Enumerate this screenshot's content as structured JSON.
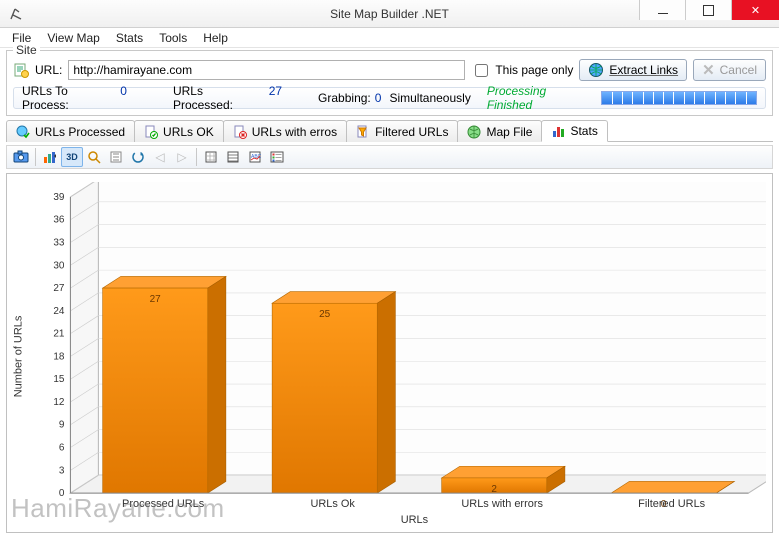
{
  "window": {
    "title": "Site Map Builder .NET",
    "minimize_label": "Minimize",
    "maximize_label": "Maximize",
    "close_label": "Close"
  },
  "menubar": [
    "File",
    "View Map",
    "Stats",
    "Tools",
    "Help"
  ],
  "site": {
    "group_label": "Site",
    "url_label": "URL:",
    "url_value": "http://hamirayane.com",
    "this_page_only_label": "This page only",
    "extract_links_label": "Extract Links",
    "cancel_label": "Cancel"
  },
  "status": {
    "urls_to_process_label": "URLs To Process:",
    "urls_to_process_value": "0",
    "urls_processed_label": "URLs Processed:",
    "urls_processed_value": "27",
    "grabbing_label": "Grabbing:",
    "grabbing_value": "0",
    "simultaneously_label": "Simultaneously",
    "processing_label": "Processing Finished"
  },
  "tabs": [
    {
      "label": "URLs Processed",
      "icon": "globe-check-icon"
    },
    {
      "label": "URLs OK",
      "icon": "page-ok-icon"
    },
    {
      "label": "URLs with erros",
      "icon": "page-error-icon"
    },
    {
      "label": "Filtered URLs",
      "icon": "filter-icon"
    },
    {
      "label": "Map File",
      "icon": "map-icon"
    },
    {
      "label": "Stats",
      "icon": "stats-icon"
    }
  ],
  "toolbar_icons": [
    "camera-icon",
    "chart-type-icon",
    "3d-toggle-icon",
    "zoom-icon",
    "scroll-icon",
    "rotate-icon",
    "left-icon",
    "right-icon",
    "grid-icon",
    "palette-icon",
    "axis-icon",
    "legend-icon"
  ],
  "chart_data": {
    "type": "bar",
    "xlabel": "URLs",
    "ylabel": "Number of URLs",
    "categories": [
      "Processed URLs",
      "URLs Ok",
      "URLs with errors",
      "Filtered URLs"
    ],
    "values": [
      27,
      25,
      2,
      0
    ],
    "ylim": [
      0,
      39
    ],
    "yticks": [
      0,
      3,
      6,
      9,
      12,
      15,
      18,
      21,
      24,
      27,
      30,
      33,
      36,
      39
    ],
    "bar_color": "#EE8300",
    "bar_color_side": "#CB6F00",
    "bar_color_top": "#FFA033"
  },
  "watermark": "HamiRayane.com"
}
